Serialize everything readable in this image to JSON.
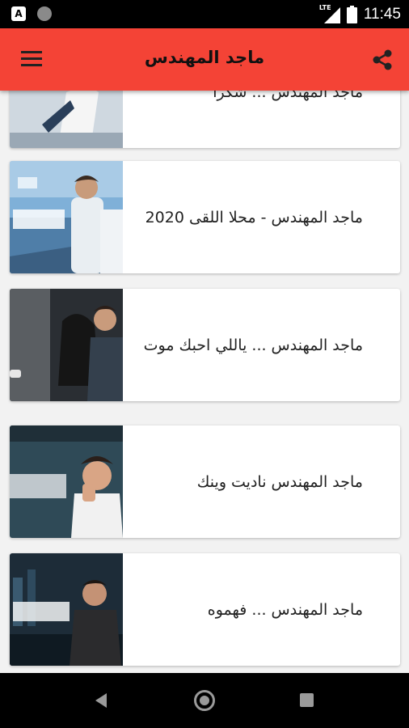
{
  "status_bar": {
    "time": "11:45",
    "network": "LTE"
  },
  "app_bar": {
    "title": "ماجد المهندس"
  },
  "cards": [
    {
      "title": "ماجد المهندس ... شكرا"
    },
    {
      "title": "ماجد المهندس - محلا اللقى 2020"
    },
    {
      "title": "ماجد المهندس ... ياللي احبك موت"
    },
    {
      "title": "ماجد المهندس ناديت وينك"
    },
    {
      "title": "ماجد المهندس ... فهموه"
    }
  ],
  "colors": {
    "app_bar": "#f44336",
    "status_bar": "#000000",
    "nav_bar": "#000000"
  }
}
